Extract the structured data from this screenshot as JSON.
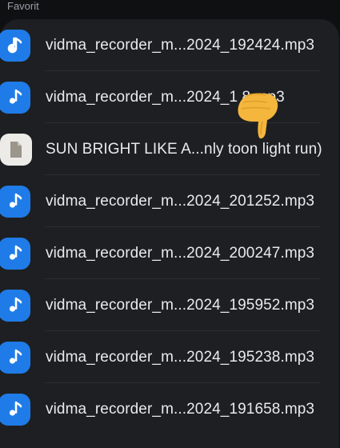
{
  "section": {
    "label": "Favorit"
  },
  "files": [
    {
      "name": "vidma_recorder_m...2024_192424.mp3",
      "type": "audio"
    },
    {
      "name": "vidma_recorder_m...2024_1      8.mp3",
      "type": "audio"
    },
    {
      "name": "SUN BRIGHT LIKE A...nly toon light run)",
      "type": "document"
    },
    {
      "name": "vidma_recorder_m...2024_201252.mp3",
      "type": "audio"
    },
    {
      "name": "vidma_recorder_m...2024_200247.mp3",
      "type": "audio"
    },
    {
      "name": "vidma_recorder_m...2024_195952.mp3",
      "type": "audio"
    },
    {
      "name": "vidma_recorder_m...2024_195238.mp3",
      "type": "audio"
    },
    {
      "name": "vidma_recorder_m...2024_191658.mp3",
      "type": "audio"
    }
  ],
  "icons": {
    "audio": "music-note-icon",
    "document": "document-icon",
    "overlay": "pointing-finger-emoji"
  },
  "colors": {
    "background": "#0f1012",
    "card": "#1e1f22",
    "audio_icon": "#1f7be8",
    "doc_icon": "#ecebe7",
    "text": "#e8eaed"
  }
}
